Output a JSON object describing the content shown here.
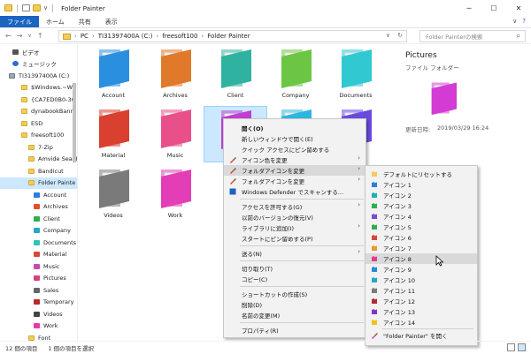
{
  "window": {
    "title": "Folder Painter",
    "min": "─",
    "max": "☐",
    "close": "✕"
  },
  "ribbon": {
    "tabs": [
      "ファイル",
      "ホーム",
      "共有",
      "表示"
    ],
    "collapse": "∨",
    "help": "?"
  },
  "address": {
    "back": "←",
    "forward": "→",
    "up": "↑",
    "path": [
      "PC",
      "TI31397400A (C:)",
      "freesoft100",
      "Folder Painter"
    ],
    "dropdown": "∨",
    "refresh": "↻",
    "search_placeholder": "Folder Painterの検索",
    "search_icon": "search-icon"
  },
  "nav": {
    "items": [
      {
        "label": "ビデオ",
        "icon": "video-icon"
      },
      {
        "label": "ミュージック",
        "icon": "music-icon"
      },
      {
        "label": "TI31397400A (C:)",
        "icon": "drive-icon"
      },
      {
        "label": "$Windows.~WS",
        "icon": "folder-icon"
      },
      {
        "label": "{CA7ED0B0-3C",
        "icon": "folder-icon"
      },
      {
        "label": "dynabookBanr",
        "icon": "folder-icon"
      },
      {
        "label": "ESD",
        "icon": "folder-icon"
      },
      {
        "label": "freesoft100",
        "icon": "folder-icon"
      },
      {
        "label": "7-Zip",
        "icon": "folder-icon"
      },
      {
        "label": "Amvide Seal F",
        "icon": "folder-icon"
      },
      {
        "label": "Bandicut",
        "icon": "folder-icon"
      },
      {
        "label": "Folder Painte",
        "icon": "folder-icon"
      },
      {
        "label": "Account",
        "icon": "folder-icon"
      },
      {
        "label": "Archives",
        "icon": "folder-icon"
      },
      {
        "label": "Client",
        "icon": "folder-icon"
      },
      {
        "label": "Company",
        "icon": "folder-icon"
      },
      {
        "label": "Documents",
        "icon": "folder-icon"
      },
      {
        "label": "Material",
        "icon": "folder-icon"
      },
      {
        "label": "Music",
        "icon": "folder-icon"
      },
      {
        "label": "Pictures",
        "icon": "folder-icon"
      },
      {
        "label": "Sales",
        "icon": "folder-icon"
      },
      {
        "label": "Temporary",
        "icon": "folder-icon"
      },
      {
        "label": "Videos",
        "icon": "folder-icon"
      },
      {
        "label": "Work",
        "icon": "folder-icon"
      },
      {
        "label": "Font",
        "icon": "folder-icon"
      }
    ],
    "selected_index": 11,
    "sub_colors": [
      "#2a7de1",
      "#e0512a",
      "#2fae4e",
      "#26a7c9",
      "#2ec4b6",
      "#d44a3a",
      "#c84ab0",
      "#d3427c",
      "#666666",
      "#b7282e",
      "#444444",
      "#e53aa9",
      "#f1c40f"
    ]
  },
  "files": [
    {
      "label": "Account",
      "color": "#2b8fe0"
    },
    {
      "label": "Archives",
      "color": "#e07a2a"
    },
    {
      "label": "Client",
      "color": "#2fb3a0"
    },
    {
      "label": "Company",
      "color": "#6cc644"
    },
    {
      "label": "Documents",
      "color": "#30c9d1"
    },
    {
      "label": "Material",
      "color": "#d94030"
    },
    {
      "label": "Music",
      "color": "#e94f8a"
    },
    {
      "label": "",
      "color": "#c03ed1"
    },
    {
      "label": "",
      "color": "#2fb6e0"
    },
    {
      "label": "",
      "color": "#6a4be0"
    },
    {
      "label": "Videos",
      "color": "#7a7a7a"
    },
    {
      "label": "Work",
      "color": "#e43eb6"
    }
  ],
  "details": {
    "title": "Pictures",
    "subtitle": "ファイル フォルダー",
    "date_label": "更新日時:",
    "date": "2019/03/29 16:24",
    "color": "#d43ad4"
  },
  "context_menu": {
    "items": [
      {
        "label": "開く(O)",
        "bold": true
      },
      {
        "label": "新しいウィンドウで開く(E)"
      },
      {
        "label": "クイック アクセスにピン留めする"
      },
      {
        "label": "アイコン色を変更",
        "icon": "paintbrush-icon",
        "arrow": true
      },
      {
        "label": "フォルダアイコンを変更",
        "icon": "paintbrush-icon",
        "arrow": true,
        "hover": true
      },
      {
        "label": "フォルダアイコンを変更",
        "icon": "paintbrush-icon",
        "arrow": true
      },
      {
        "label": "Windows Defender でスキャンする...",
        "icon": "defender-icon"
      },
      {
        "sep": true
      },
      {
        "label": "アクセスを許可する(G)",
        "arrow": true
      },
      {
        "label": "以前のバージョンの復元(V)"
      },
      {
        "label": "ライブラリに追加(I)",
        "arrow": true
      },
      {
        "label": "スタートにピン留めする(P)"
      },
      {
        "sep": true
      },
      {
        "label": "送る(N)",
        "arrow": true
      },
      {
        "sep": true
      },
      {
        "label": "切り取り(T)"
      },
      {
        "label": "コピー(C)"
      },
      {
        "sep": true
      },
      {
        "label": "ショートカットの作成(S)"
      },
      {
        "label": "削除(D)"
      },
      {
        "label": "名前の変更(M)"
      },
      {
        "sep": true
      },
      {
        "label": "プロパティ(R)"
      }
    ]
  },
  "submenu": {
    "items": [
      {
        "label": "デフォルトにリセットする",
        "color": "#f3cd55"
      },
      {
        "label": "アイコン 1",
        "color": "#2a7de1"
      },
      {
        "label": "アイコン 2",
        "color": "#20b2aa"
      },
      {
        "label": "アイコン 3",
        "color": "#2fae4e"
      },
      {
        "label": "アイコン 4",
        "color": "#7c4bd6"
      },
      {
        "label": "アイコン 5",
        "color": "#2fae4e"
      },
      {
        "label": "アイコン 6",
        "color": "#d44a3a"
      },
      {
        "label": "アイコン 7",
        "color": "#e89b2a"
      },
      {
        "label": "アイコン 8",
        "color": "#e53a90",
        "hover": true
      },
      {
        "label": "アイコン 9",
        "color": "#2a8ad6"
      },
      {
        "label": "アイコン 10",
        "color": "#26a7c9"
      },
      {
        "label": "アイコン 11",
        "color": "#7a7a7a"
      },
      {
        "label": "アイコン 12",
        "color": "#b7282e"
      },
      {
        "label": "アイコン 13",
        "color": "#7c3ac2"
      },
      {
        "label": "アイコン 14",
        "color": "#f1c40f"
      },
      {
        "sep": true
      },
      {
        "label": "\"Folder Painter\" を開く",
        "color": "#c03ed1",
        "icon": "paintbrush-icon"
      }
    ]
  },
  "status": {
    "count": "12 個の項目",
    "selected": "1 個の項目を選択"
  }
}
